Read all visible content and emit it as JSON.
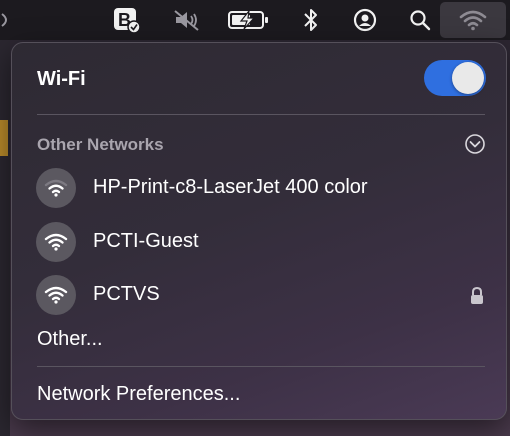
{
  "menubar": {
    "icons": [
      "partial-app-icon",
      "b-app-icon",
      "mute-icon",
      "battery-charging-icon",
      "bluetooth-icon",
      "user-icon",
      "search-icon",
      "wifi-icon"
    ]
  },
  "panel": {
    "title": "Wi-Fi",
    "wifi_enabled": true,
    "section_label": "Other Networks",
    "networks": [
      {
        "name": "HP-Print-c8-LaserJet 400 color",
        "locked": false,
        "signal_bars": 2
      },
      {
        "name": "PCTI-Guest",
        "locked": false,
        "signal_bars": 3
      },
      {
        "name": "PCTVS",
        "locked": true,
        "signal_bars": 3
      }
    ],
    "other_label": "Other...",
    "prefs_label": "Network Preferences..."
  },
  "colors": {
    "toggle_on": "#2f6fe0",
    "icon_circle": "#5b5860",
    "section_label": "#a9a5ae"
  }
}
